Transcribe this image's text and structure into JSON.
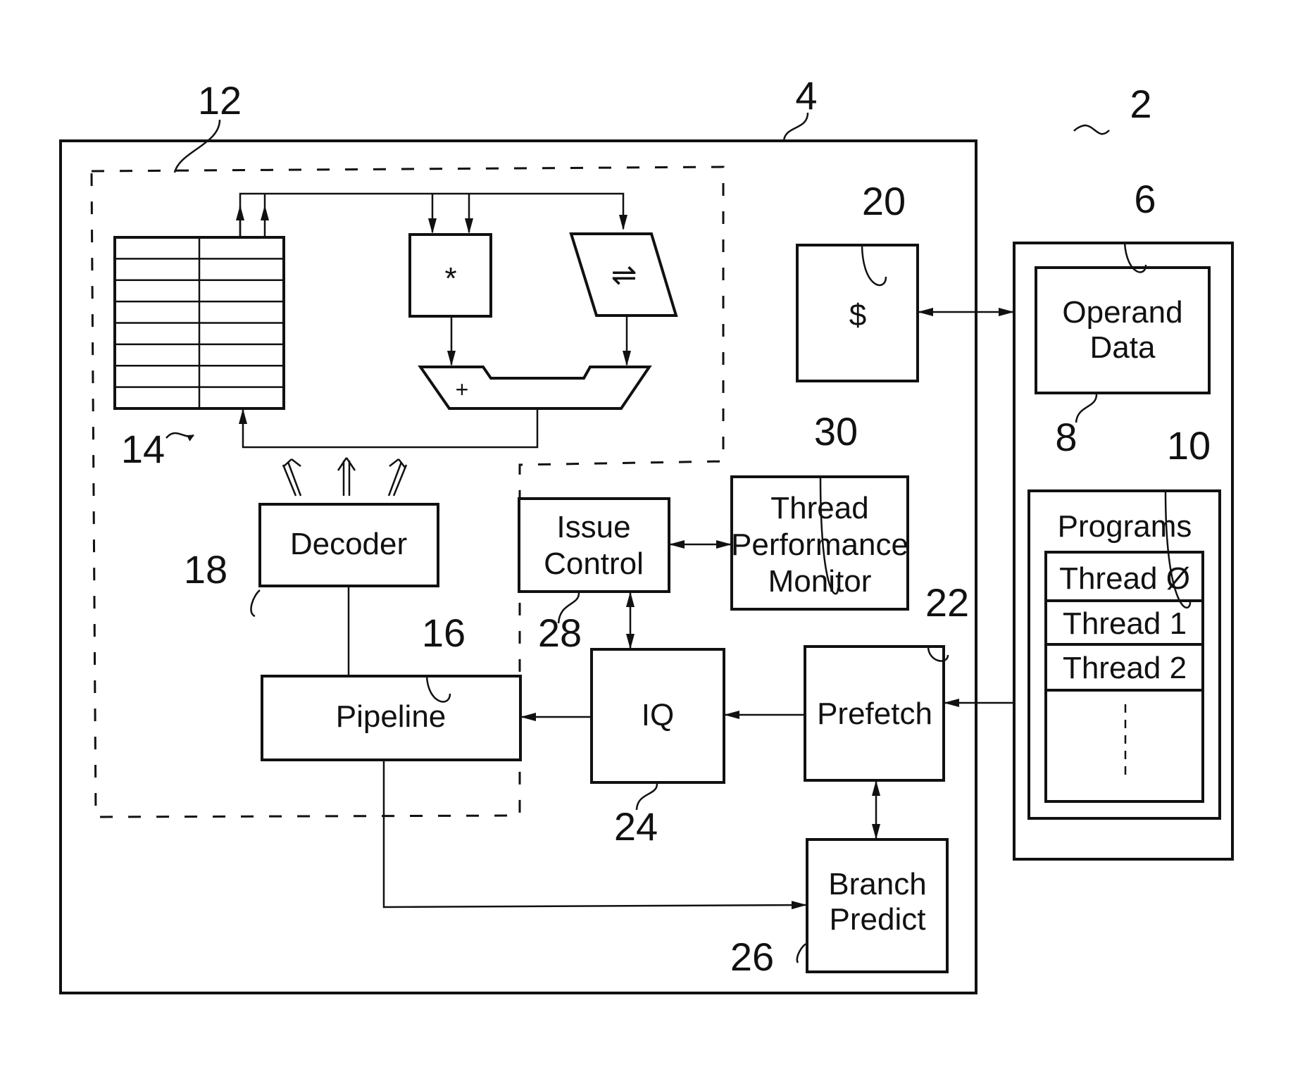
{
  "figure": {
    "reference_numerals": {
      "system": "2",
      "processor": "4",
      "memory": "6",
      "operand_data": "8",
      "programs": "10",
      "execution_unit": "12",
      "register_file": "14",
      "pipeline": "16",
      "decoder": "18",
      "cache": "20",
      "prefetch": "22",
      "issue_queue": "24",
      "branch_predict": "26",
      "issue_control": "28",
      "thread_performance_monitor": "30"
    },
    "blocks": {
      "cache": "$",
      "multiplier": "*",
      "shifter": "⇌",
      "adder": "+",
      "decoder": "Decoder",
      "pipeline": "Pipeline",
      "issue_control": [
        "Issue",
        "Control"
      ],
      "thread_performance_monitor": [
        "Thread",
        "Performance",
        "Monitor"
      ],
      "issue_queue": "IQ",
      "prefetch": "Prefetch",
      "branch_predict": [
        "Branch",
        "Predict"
      ],
      "operand_data": [
        "Operand",
        "Data"
      ],
      "programs": "Programs",
      "threads": [
        "Thread Ø",
        "Thread 1",
        "Thread 2"
      ]
    }
  }
}
